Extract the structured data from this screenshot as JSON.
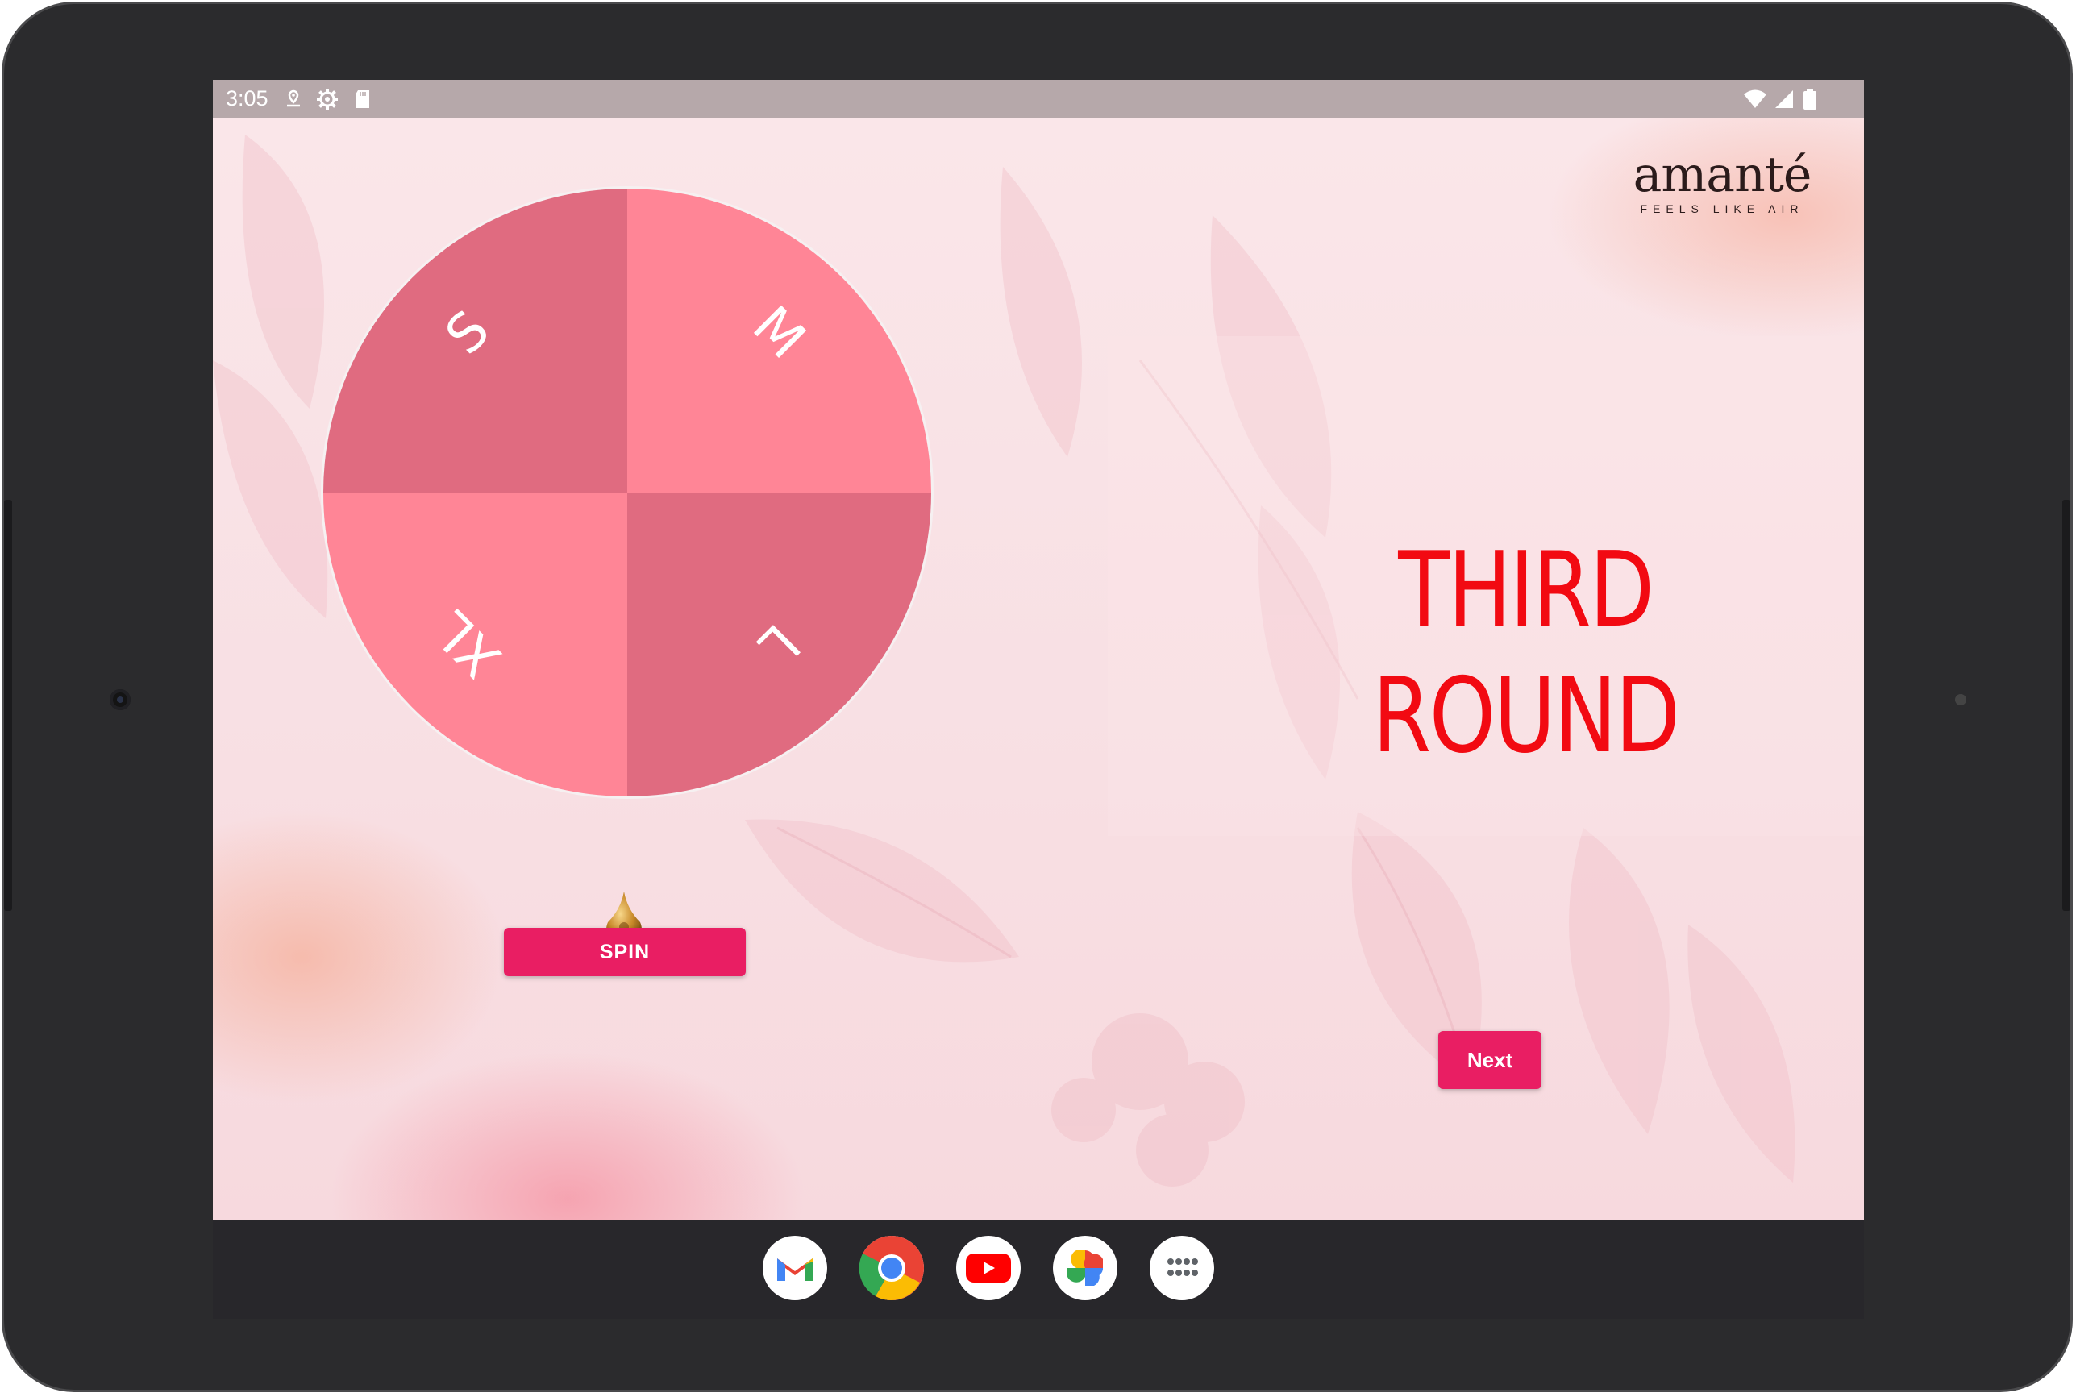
{
  "status_bar": {
    "time": "3:05",
    "left_icons": [
      "location-icon",
      "settings-gear-icon",
      "sd-card-icon"
    ],
    "right_icons": [
      "wifi-icon",
      "signal-icon",
      "battery-icon"
    ]
  },
  "logo": {
    "brand": "amanté",
    "tagline": "FEELS LIKE AIR"
  },
  "wheel": {
    "segments": [
      {
        "label": "S",
        "color": "#e06b80"
      },
      {
        "label": "M",
        "color": "#ff8596"
      },
      {
        "label": "XL",
        "color": "#ff8596"
      },
      {
        "label": "L",
        "color": "#e06b80"
      }
    ]
  },
  "spin_button": {
    "label": "SPIN"
  },
  "round_title": {
    "line1": "THIRD",
    "line2": "ROUND"
  },
  "next_button": {
    "label": "Next"
  },
  "colors": {
    "accent": "#e91e63",
    "title": "#f20a12"
  },
  "dock": {
    "apps": [
      {
        "name": "gmail-icon"
      },
      {
        "name": "chrome-icon"
      },
      {
        "name": "youtube-icon"
      },
      {
        "name": "photos-icon"
      },
      {
        "name": "app-drawer-icon"
      }
    ]
  }
}
